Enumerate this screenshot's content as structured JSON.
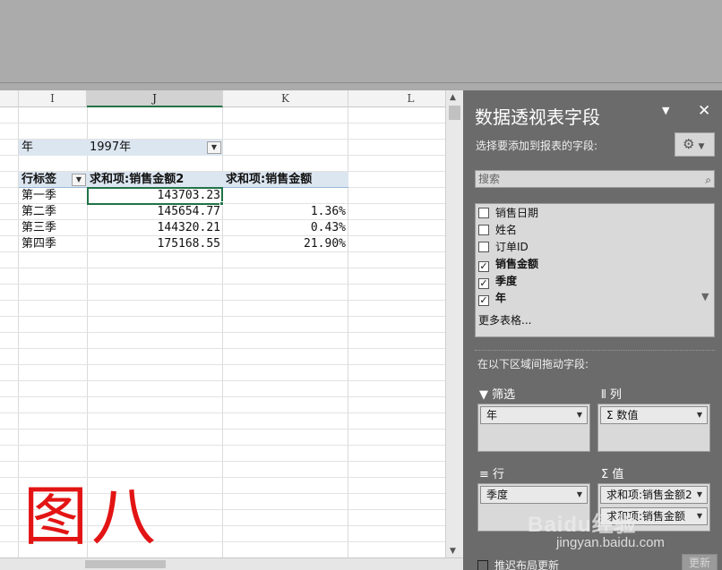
{
  "sheet": {
    "columns": [
      "I",
      "J",
      "K",
      "L"
    ],
    "filter": {
      "label": "年",
      "value": "1997年"
    },
    "pivot_headers": {
      "row_label": "行标签",
      "value1": "求和项:销售金额2",
      "value2": "求和项:销售金额"
    },
    "rows": [
      {
        "label": "第一季",
        "v1": "143703.23",
        "v2": ""
      },
      {
        "label": "第二季",
        "v1": "145654.77",
        "v2": "1.36%"
      },
      {
        "label": "第三季",
        "v1": "144320.21",
        "v2": "0.43%"
      },
      {
        "label": "第四季",
        "v1": "175168.55",
        "v2": "21.90%"
      }
    ],
    "watermark_text": "图八"
  },
  "panel": {
    "title": "数据透视表字段",
    "subtitle": "选择要添加到报表的字段:",
    "search_placeholder": "搜索",
    "fields": [
      {
        "name": "销售日期",
        "checked": false
      },
      {
        "name": "姓名",
        "checked": false
      },
      {
        "name": "订单ID",
        "checked": false
      },
      {
        "name": "销售金额",
        "checked": true
      },
      {
        "name": "季度",
        "checked": true
      },
      {
        "name": "年",
        "checked": true
      }
    ],
    "more_tables": "更多表格...",
    "drag_label": "在以下区域间拖动字段:",
    "areas": {
      "filters": {
        "title": "筛选",
        "items": [
          "年"
        ]
      },
      "columns": {
        "title": "列",
        "items": [
          "Σ 数值"
        ]
      },
      "rows": {
        "title": "行",
        "items": [
          "季度"
        ]
      },
      "values": {
        "title": "值",
        "items": [
          "求和项:销售金额2",
          "求和项:销售金额"
        ]
      }
    },
    "defer_label": "推迟布局更新",
    "update_label": "更新"
  },
  "watermark": {
    "brand": "Baidu经验",
    "url": "jingyan.baidu.com"
  }
}
